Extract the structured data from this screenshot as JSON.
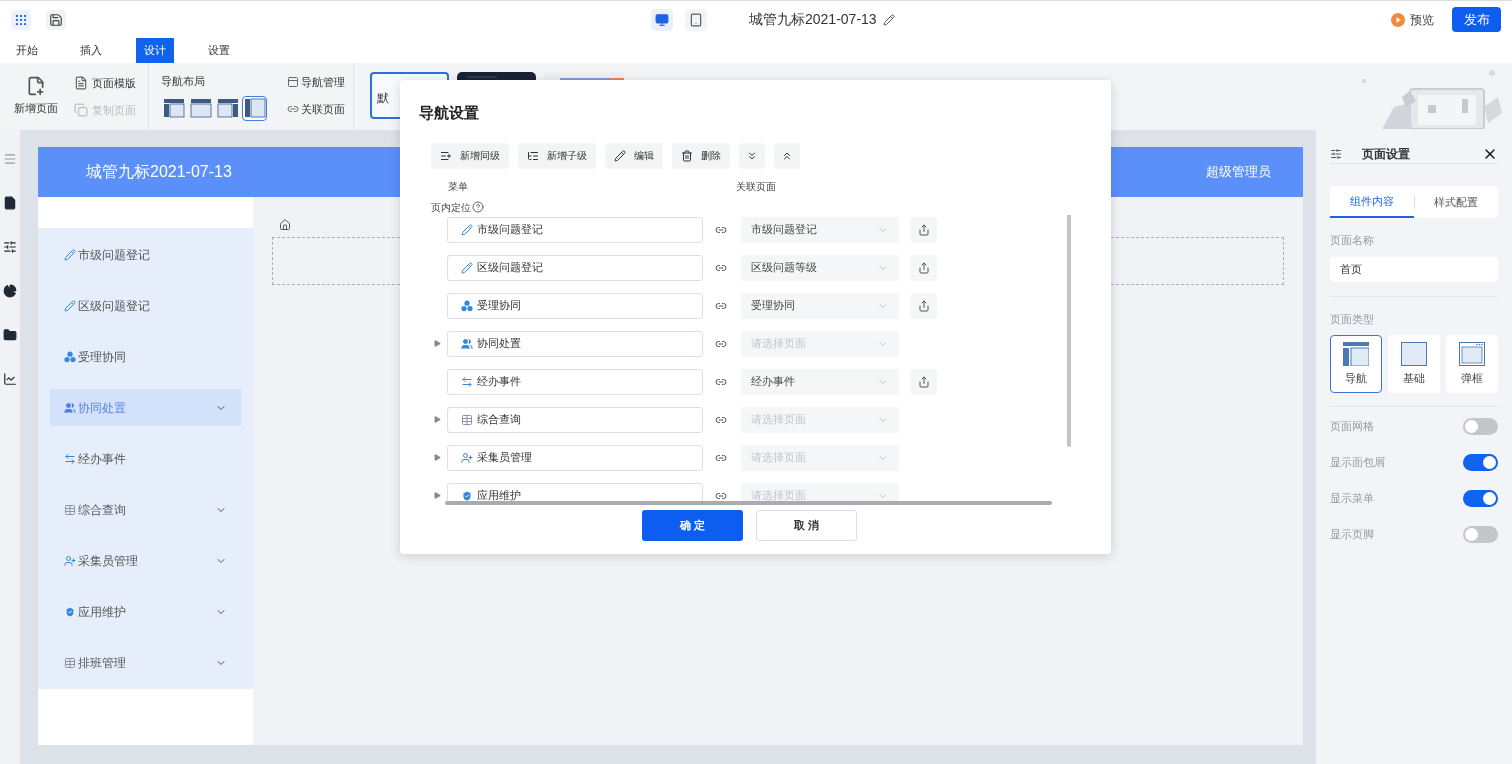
{
  "toolbar": {
    "title": "城管九标2021-07-13",
    "preview": "预览",
    "publish": "发布",
    "devices": [
      {
        "kind": "desktop",
        "selected": true
      },
      {
        "kind": "tablet",
        "selected": false
      }
    ]
  },
  "menu_tabs": [
    {
      "label": "开始",
      "selected": false
    },
    {
      "label": "插入",
      "selected": false
    },
    {
      "label": "设计",
      "selected": true
    },
    {
      "label": "设置",
      "selected": false
    }
  ],
  "ribbon": {
    "new_page": "新增页面",
    "template": "页面模版",
    "copy_page": {
      "label": "复制页面",
      "disabled": true
    },
    "nav_layout": {
      "label": "导航布局",
      "layouts": [
        {
          "kind": "top-side",
          "selected": false
        },
        {
          "kind": "top",
          "selected": false
        },
        {
          "kind": "top-right",
          "selected": false
        },
        {
          "kind": "side",
          "selected": true
        }
      ]
    },
    "nav_manage": "导航管理",
    "link_page": "关联页面",
    "theme_label": "默"
  },
  "preview": {
    "title": "城管九标2021-07-13",
    "user": "超级管理员",
    "menu": [
      {
        "label": "市级问题登记",
        "kind": "pencil",
        "selected": false,
        "expandable": false
      },
      {
        "label": "区级问题登记",
        "kind": "pencil",
        "selected": false,
        "expandable": false
      },
      {
        "label": "受理协同",
        "kind": "cluster",
        "selected": false,
        "expandable": false
      },
      {
        "label": "协同处置",
        "kind": "users",
        "selected": true,
        "expandable": true
      },
      {
        "label": "经办事件",
        "kind": "swap",
        "selected": false,
        "expandable": false
      },
      {
        "label": "综合查询",
        "kind": "table",
        "selected": false,
        "expandable": true
      },
      {
        "label": "采集员管理",
        "kind": "user-add",
        "selected": false,
        "expandable": true
      },
      {
        "label": "应用维护",
        "kind": "shield",
        "selected": false,
        "expandable": true
      },
      {
        "label": "排班管理",
        "kind": "table",
        "selected": false,
        "expandable": true
      }
    ]
  },
  "dialog": {
    "title": "导航设置",
    "actions": [
      {
        "label": "新增同级",
        "kind": "add-sibling"
      },
      {
        "label": "新增子级",
        "kind": "add-child"
      },
      {
        "label": "编辑",
        "kind": "edit"
      },
      {
        "label": "删除",
        "kind": "delete"
      },
      {
        "kind": "expand-all"
      },
      {
        "kind": "collapse-all"
      }
    ],
    "menu_header": "菜单",
    "page_header": "关联页面",
    "anchor_label": "页内定位",
    "rows": [
      {
        "label": "市级问题登记",
        "kind": "pencil",
        "expandable": false,
        "page": "市级问题登记"
      },
      {
        "label": "区级问题登记",
        "kind": "pencil",
        "expandable": false,
        "page": "区级问题等级"
      },
      {
        "label": "受理协同",
        "kind": "cluster",
        "expandable": false,
        "page": "受理协同"
      },
      {
        "label": "协同处置",
        "kind": "users",
        "expandable": true,
        "placeholder": "请选择页面"
      },
      {
        "label": "经办事件",
        "kind": "swap",
        "expandable": false,
        "page": "经办事件"
      },
      {
        "label": "综合查询",
        "kind": "table",
        "expandable": true,
        "placeholder": "请选择页面"
      },
      {
        "label": "采集员管理",
        "kind": "user-add",
        "expandable": true,
        "placeholder": "请选择页面"
      },
      {
        "label": "应用维护",
        "kind": "shield",
        "expandable": true,
        "placeholder": "请选择页面"
      }
    ],
    "ok": "确 定",
    "cancel": "取 消"
  },
  "settings": {
    "title": "页面设置",
    "tabs": [
      {
        "label": "组件内容",
        "selected": true
      },
      {
        "label": "样式配置",
        "selected": false
      }
    ],
    "name_label": "页面名称",
    "name_value": "首页",
    "type_label": "页面类型",
    "types": [
      {
        "label": "导航",
        "kind": "nav",
        "selected": true
      },
      {
        "label": "基础",
        "kind": "basic",
        "selected": false
      },
      {
        "label": "弹框",
        "kind": "popup",
        "selected": false
      }
    ],
    "toggles": [
      {
        "label": "页面网格",
        "on": false
      },
      {
        "label": "显示面包屑",
        "on": true
      },
      {
        "label": "显示菜单",
        "on": true
      },
      {
        "label": "显示页脚",
        "on": false
      }
    ]
  }
}
